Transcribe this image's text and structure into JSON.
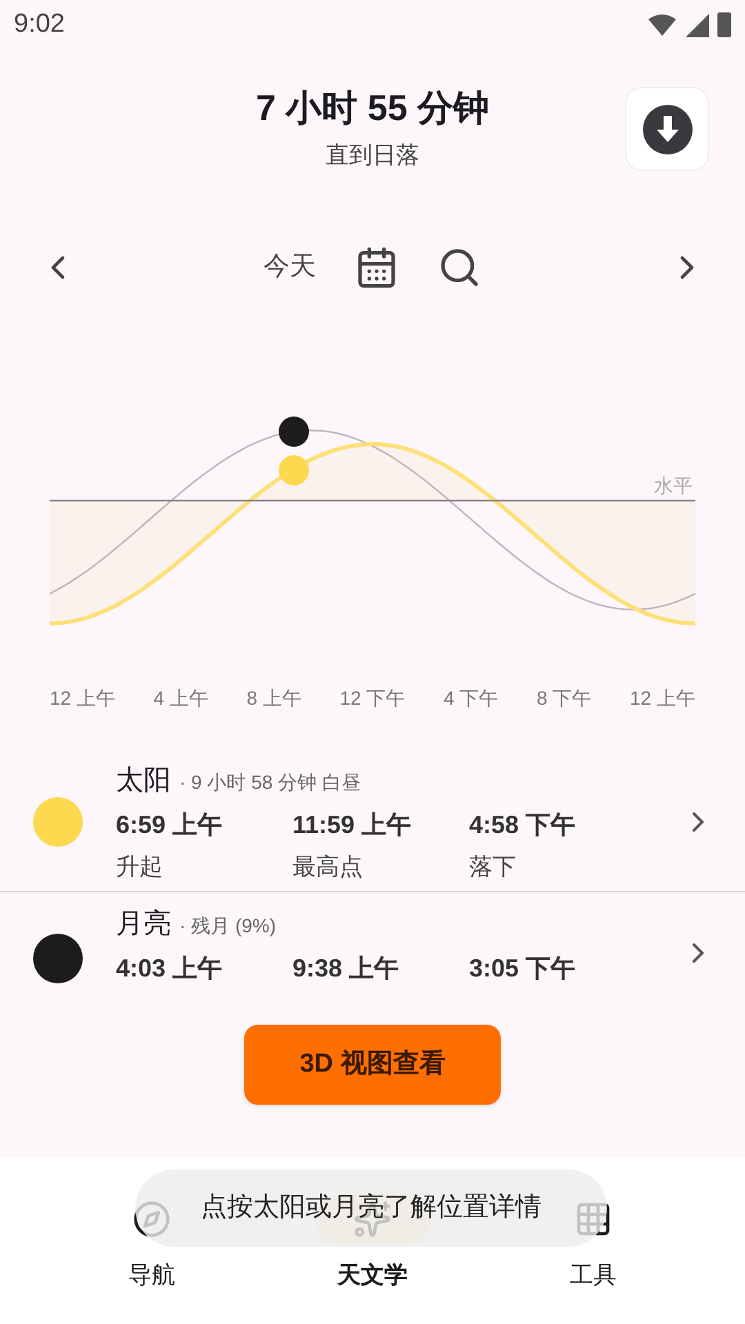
{
  "status_bar": {
    "time": "9:02"
  },
  "header": {
    "title": "7 小时 55 分钟",
    "subtitle": "直到日落"
  },
  "date_nav": {
    "label": "今天"
  },
  "chart": {
    "horizon_label": "水平",
    "x_labels": [
      "12 上午",
      "4 上午",
      "8 上午",
      "12 下午",
      "4 下午",
      "8 下午",
      "12 上午"
    ]
  },
  "bodies": [
    {
      "name": "太阳",
      "detail": "· 9 小时 58 分钟 白昼",
      "color": "#fdd94f",
      "times": [
        {
          "time": "6:59 上午",
          "label": "升起"
        },
        {
          "time": "11:59 上午",
          "label": "最高点"
        },
        {
          "time": "4:58 下午",
          "label": "落下"
        }
      ]
    },
    {
      "name": "月亮",
      "detail": "· 残月 (9%)",
      "color": "#1c1c1c",
      "times": [
        {
          "time": "4:03 上午"
        },
        {
          "time": "9:38 上午"
        },
        {
          "time": "3:05 下午"
        }
      ]
    }
  ],
  "action_button": "3D 视图查看",
  "bottom_nav": [
    {
      "label": "导航",
      "selected": false
    },
    {
      "label": "天文学",
      "selected": true
    },
    {
      "label": "工具",
      "selected": false
    }
  ],
  "toast": "点按太阳或月亮了解位置详情"
}
